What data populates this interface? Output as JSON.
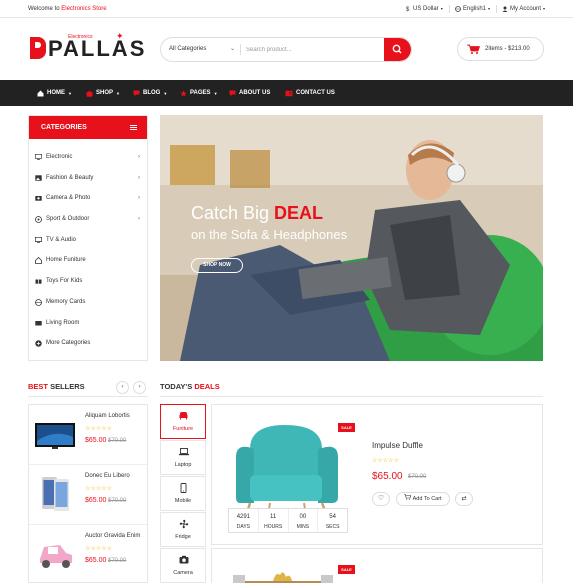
{
  "topbar": {
    "welcome_prefix": "Welcome to ",
    "welcome_brand": "Electronics Store",
    "currency": "US Dollar",
    "language": "English1",
    "account": "My Account"
  },
  "logo": {
    "text": "PALLAS",
    "sup": "Electronics"
  },
  "search": {
    "category": "All Categories",
    "placeholder": "Search product..."
  },
  "cart": {
    "label": "2items - $213.00"
  },
  "nav": {
    "items": [
      "HOME",
      "SHOP",
      "BLOG",
      "PAGES",
      "ABOUT US",
      "CONTACT US"
    ]
  },
  "categories": {
    "title": "CATEGORIES",
    "items": [
      "Electronic",
      "Fashion & Beauty",
      "Camera & Photo",
      "Sport & Outdoor",
      "TV & Audio",
      "Home Funiture",
      "Toys For Kids",
      "Memory Cards",
      "Living Room",
      "More Categories"
    ]
  },
  "banner": {
    "line1_prefix": "Catch Big ",
    "line1_deal": "DEAL",
    "line2": "on the Sofa & Headphones",
    "button": "SHOP NOW"
  },
  "best_sellers": {
    "title_red": "BEST",
    "title_rest": " SELLERS",
    "items": [
      {
        "name": "Aliquam Lobortis",
        "price": "$65.00",
        "old_price": "$70.00",
        "stars": "☆☆☆☆☆"
      },
      {
        "name": "Donec Eu Libero",
        "price": "$65.00",
        "old_price": "$70.00",
        "stars": "☆☆☆☆☆"
      },
      {
        "name": "Auctor Gravida Enim",
        "price": "$65.00",
        "old_price": "$70.00",
        "stars": "☆☆☆☆☆"
      }
    ]
  },
  "deals": {
    "title_prefix": "TODAY'S",
    "title_red": "DEALS",
    "tabs": [
      "Funiture",
      "Laptop",
      "Mobile",
      "Fridge",
      "Camera"
    ],
    "sale_badge": "SALE",
    "product": {
      "name": "Impulse Duffle",
      "stars": "☆☆☆☆☆",
      "price": "$65.00",
      "old_price": "$70.00",
      "add_to_cart": "Add To Cart"
    },
    "countdown": [
      {
        "value": "4291",
        "unit": "DAYS"
      },
      {
        "value": "11",
        "unit": "HOURS"
      },
      {
        "value": "00",
        "unit": "MINS"
      },
      {
        "value": "54",
        "unit": "SECS"
      }
    ]
  },
  "colors": {
    "accent": "#e8101a",
    "dark": "#222222"
  }
}
